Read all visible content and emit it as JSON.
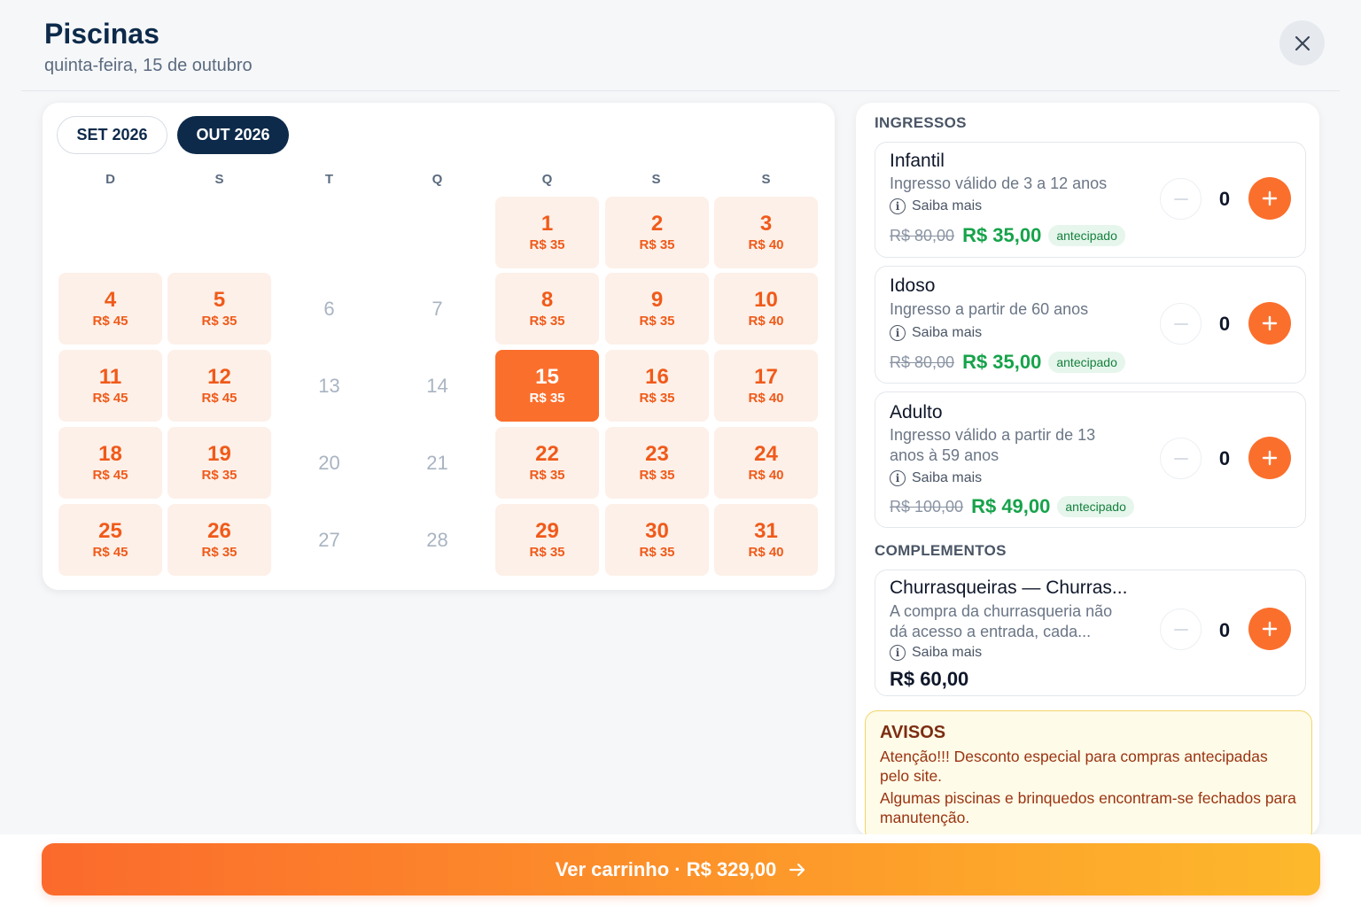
{
  "header": {
    "title": "Piscinas",
    "subtitle": "quinta-feira, 15 de outubro",
    "close_icon": "close-icon"
  },
  "calendar": {
    "months": [
      {
        "label": "SET 2026",
        "active": false
      },
      {
        "label": "OUT 2026",
        "active": true
      }
    ],
    "weekdays": [
      "D",
      "S",
      "T",
      "Q",
      "Q",
      "S",
      "S"
    ],
    "selected_day": "15",
    "days": [
      {
        "day": "1",
        "price": "R$ 35",
        "status": "available"
      },
      {
        "day": "2",
        "price": "R$ 35",
        "status": "available"
      },
      {
        "day": "3",
        "price": "R$ 40",
        "status": "available"
      },
      {
        "day": "4",
        "price": "R$ 45",
        "status": "available"
      },
      {
        "day": "5",
        "price": "R$ 35",
        "status": "available"
      },
      {
        "day": "6",
        "price": "",
        "status": "unavailable"
      },
      {
        "day": "7",
        "price": "",
        "status": "unavailable"
      },
      {
        "day": "8",
        "price": "R$ 35",
        "status": "available"
      },
      {
        "day": "9",
        "price": "R$ 35",
        "status": "available"
      },
      {
        "day": "10",
        "price": "R$ 40",
        "status": "available"
      },
      {
        "day": "11",
        "price": "R$ 45",
        "status": "available"
      },
      {
        "day": "12",
        "price": "R$ 45",
        "status": "available"
      },
      {
        "day": "13",
        "price": "",
        "status": "unavailable"
      },
      {
        "day": "14",
        "price": "",
        "status": "unavailable"
      },
      {
        "day": "15",
        "price": "R$ 35",
        "status": "selected"
      },
      {
        "day": "16",
        "price": "R$ 35",
        "status": "available"
      },
      {
        "day": "17",
        "price": "R$ 40",
        "status": "available"
      },
      {
        "day": "18",
        "price": "R$ 45",
        "status": "available"
      },
      {
        "day": "19",
        "price": "R$ 35",
        "status": "available"
      },
      {
        "day": "20",
        "price": "",
        "status": "unavailable"
      },
      {
        "day": "21",
        "price": "",
        "status": "unavailable"
      },
      {
        "day": "22",
        "price": "R$ 35",
        "status": "available"
      },
      {
        "day": "23",
        "price": "R$ 35",
        "status": "available"
      },
      {
        "day": "24",
        "price": "R$ 40",
        "status": "available"
      },
      {
        "day": "25",
        "price": "R$ 45",
        "status": "available"
      },
      {
        "day": "26",
        "price": "R$ 35",
        "status": "available"
      },
      {
        "day": "27",
        "price": "",
        "status": "unavailable"
      },
      {
        "day": "28",
        "price": "",
        "status": "unavailable"
      },
      {
        "day": "29",
        "price": "R$ 35",
        "status": "available"
      },
      {
        "day": "30",
        "price": "R$ 35",
        "status": "available"
      },
      {
        "day": "31",
        "price": "R$ 40",
        "status": "available"
      }
    ]
  },
  "tickets": {
    "section_label": "INGRESSOS",
    "info_label": "Saiba mais",
    "items": [
      {
        "name": "Infantil",
        "desc": "Ingresso válido de 3 a 12 anos",
        "old_price": "R$ 80,00",
        "new_price": "R$ 35,00",
        "badge": "antecipado",
        "qty": "0"
      },
      {
        "name": "Idoso",
        "desc": "Ingresso a partir de 60 anos",
        "old_price": "R$ 80,00",
        "new_price": "R$ 35,00",
        "badge": "antecipado",
        "qty": "0"
      },
      {
        "name": "Adulto",
        "desc": "Ingresso válido a partir de 13 anos à 59 anos",
        "old_price": "R$ 100,00",
        "new_price": "R$ 49,00",
        "badge": "antecipado",
        "qty": "0"
      }
    ]
  },
  "complements": {
    "section_label": "COMPLEMENTOS",
    "items": [
      {
        "name": "Churrasqueiras — Churras...",
        "desc": "A compra da churrasqueria não dá acesso a entrada, cada...",
        "price": "R$ 60,00",
        "qty": "0"
      }
    ]
  },
  "notices": {
    "title": "AVISOS",
    "lines": [
      "Atenção!!! Desconto especial para compras antecipadas pelo site.",
      "Algumas piscinas e brinquedos encontram-se fechados para manutenção."
    ]
  },
  "cart": {
    "label": "Ver carrinho · R$ 329,00",
    "icon": "arrow-right-icon"
  },
  "colors": {
    "accent": "#fb6f2d",
    "navy": "#0d2a4a",
    "green": "#16a34a"
  }
}
